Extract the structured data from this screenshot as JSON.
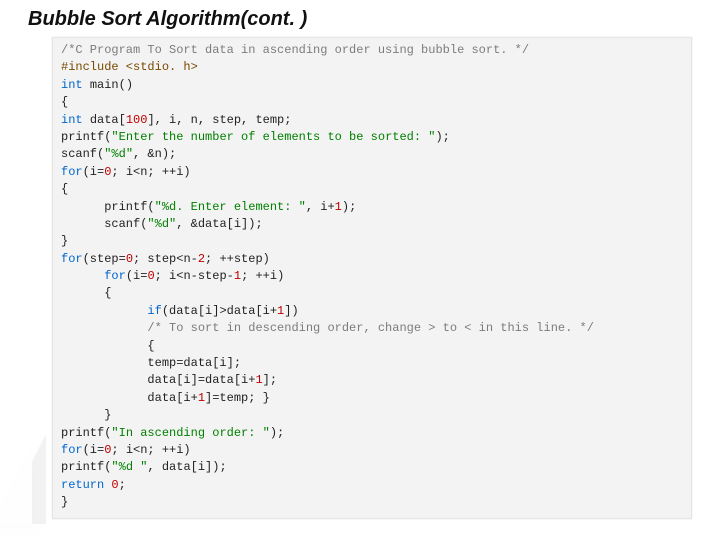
{
  "title": "Bubble Sort Algorithm(cont. )",
  "code": {
    "lines": [
      [
        {
          "t": "/*C Program To Sort data in ascending order using bubble sort. */",
          "c": "c-comment"
        }
      ],
      [
        {
          "t": "#include <stdio. h>",
          "c": "c-macro"
        }
      ],
      [
        {
          "t": "int ",
          "c": "c-type"
        },
        {
          "t": "main()",
          "c": ""
        }
      ],
      [
        {
          "t": "{",
          "c": ""
        }
      ],
      [
        {
          "t": "int ",
          "c": "c-type"
        },
        {
          "t": "data[",
          "c": ""
        },
        {
          "t": "100",
          "c": "c-num"
        },
        {
          "t": "], i, n, step, temp;",
          "c": ""
        }
      ],
      [
        {
          "t": "printf(",
          "c": ""
        },
        {
          "t": "\"Enter the number of elements to be sorted: \"",
          "c": "c-str"
        },
        {
          "t": ");",
          "c": ""
        }
      ],
      [
        {
          "t": "scanf(",
          "c": ""
        },
        {
          "t": "\"%d\"",
          "c": "c-str"
        },
        {
          "t": ", &n);",
          "c": ""
        }
      ],
      [
        {
          "t": "for",
          "c": "c-type"
        },
        {
          "t": "(i=",
          "c": ""
        },
        {
          "t": "0",
          "c": "c-num"
        },
        {
          "t": "; i<n; ++i)",
          "c": ""
        }
      ],
      [
        {
          "t": "{",
          "c": ""
        }
      ],
      [
        {
          "t": "      printf(",
          "c": ""
        },
        {
          "t": "\"%d. Enter element: \"",
          "c": "c-str"
        },
        {
          "t": ", i+",
          "c": ""
        },
        {
          "t": "1",
          "c": "c-num"
        },
        {
          "t": ");",
          "c": ""
        }
      ],
      [
        {
          "t": "      scanf(",
          "c": ""
        },
        {
          "t": "\"%d\"",
          "c": "c-str"
        },
        {
          "t": ", &data[i]);",
          "c": ""
        }
      ],
      [
        {
          "t": "}",
          "c": ""
        }
      ],
      [
        {
          "t": "for",
          "c": "c-type"
        },
        {
          "t": "(step=",
          "c": ""
        },
        {
          "t": "0",
          "c": "c-num"
        },
        {
          "t": "; step<n-",
          "c": ""
        },
        {
          "t": "2",
          "c": "c-num"
        },
        {
          "t": "; ++step)",
          "c": ""
        }
      ],
      [
        {
          "t": "      ",
          "c": ""
        },
        {
          "t": "for",
          "c": "c-type"
        },
        {
          "t": "(i=",
          "c": ""
        },
        {
          "t": "0",
          "c": "c-num"
        },
        {
          "t": "; i<n-step-",
          "c": ""
        },
        {
          "t": "1",
          "c": "c-num"
        },
        {
          "t": "; ++i)",
          "c": ""
        }
      ],
      [
        {
          "t": "      {",
          "c": ""
        }
      ],
      [
        {
          "t": "            ",
          "c": ""
        },
        {
          "t": "if",
          "c": "c-type"
        },
        {
          "t": "(data[i]>data[i+",
          "c": ""
        },
        {
          "t": "1",
          "c": "c-num"
        },
        {
          "t": "])",
          "c": ""
        }
      ],
      [
        {
          "t": "            ",
          "c": ""
        },
        {
          "t": "/* To sort in descending order, change > to < in this line. */",
          "c": "c-comment"
        }
      ],
      [
        {
          "t": "            {",
          "c": ""
        }
      ],
      [
        {
          "t": "            temp=data[i];",
          "c": ""
        }
      ],
      [
        {
          "t": "            data[i]=data[i+",
          "c": ""
        },
        {
          "t": "1",
          "c": "c-num"
        },
        {
          "t": "];",
          "c": ""
        }
      ],
      [
        {
          "t": "            data[i+",
          "c": ""
        },
        {
          "t": "1",
          "c": "c-num"
        },
        {
          "t": "]=temp; }",
          "c": ""
        }
      ],
      [
        {
          "t": "      }",
          "c": ""
        }
      ],
      [
        {
          "t": "printf(",
          "c": ""
        },
        {
          "t": "\"In ascending order: \"",
          "c": "c-str"
        },
        {
          "t": ");",
          "c": ""
        }
      ],
      [
        {
          "t": "for",
          "c": "c-type"
        },
        {
          "t": "(i=",
          "c": ""
        },
        {
          "t": "0",
          "c": "c-num"
        },
        {
          "t": "; i<n; ++i)",
          "c": ""
        }
      ],
      [
        {
          "t": "printf(",
          "c": ""
        },
        {
          "t": "\"%d \"",
          "c": "c-str"
        },
        {
          "t": ", data[i]);",
          "c": ""
        }
      ],
      [
        {
          "t": "return ",
          "c": "c-type"
        },
        {
          "t": "0",
          "c": "c-num"
        },
        {
          "t": ";",
          "c": ""
        }
      ],
      [
        {
          "t": "}",
          "c": ""
        }
      ]
    ]
  }
}
